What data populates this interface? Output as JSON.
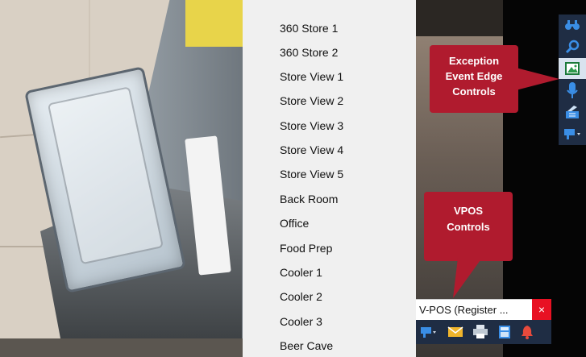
{
  "camera_menu": {
    "items": [
      "360 Store 1",
      "360 Store 2",
      "Store View 1",
      "Store View 2",
      "Store View 3",
      "Store View 4",
      "Store View 5",
      "Back Room",
      "Office",
      "Food Prep",
      "Cooler 1",
      "Cooler 2",
      "Cooler 3",
      "Beer Cave"
    ]
  },
  "callouts": {
    "exception": {
      "line1": "Exception",
      "line2": "Event Edge",
      "line3": "Controls"
    },
    "vpos": {
      "line1": "VPOS",
      "line2": "Controls"
    }
  },
  "toolbar": {
    "icons": [
      "binoculars-icon",
      "search-icon",
      "image-icon",
      "microphone-icon",
      "register-receipt-icon",
      "camera-dropdown-icon"
    ]
  },
  "vpos_window": {
    "title": "V-POS (Register ...",
    "close_label": "×",
    "icons": [
      "camera-dropdown-icon",
      "mail-icon",
      "printer-icon",
      "calculator-icon",
      "bell-icon"
    ]
  },
  "colors": {
    "callout_red": "#b01b2e",
    "toolbar_navy": "#1f2d44",
    "close_red": "#e81123",
    "icon_blue": "#3a8ee6"
  }
}
